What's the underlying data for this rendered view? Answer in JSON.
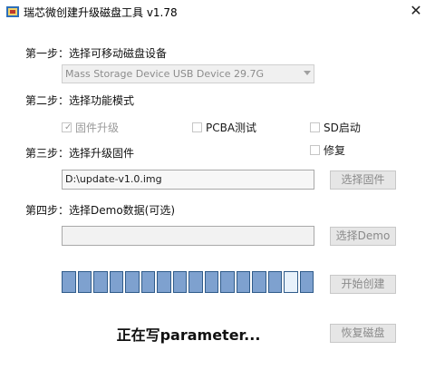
{
  "window": {
    "title": "瑞芯微创建升级磁盘工具 v1.78",
    "close_symbol": "✕"
  },
  "step1": {
    "label": "第一步：选择可移动磁盘设备",
    "selected_device": "Mass Storage Device USB Device   29.7G"
  },
  "step2": {
    "label": "第二步：选择功能模式",
    "options": {
      "firmware_upgrade": {
        "label": "固件升级",
        "checked": true
      },
      "pcba_test": {
        "label": "PCBA测试",
        "checked": false
      },
      "sd_boot": {
        "label": "SD启动",
        "checked": false
      },
      "repair": {
        "label": "修复",
        "checked": false
      }
    }
  },
  "step3": {
    "label": "第三步：选择升级固件",
    "firmware_path": "D:\\update-v1.0.img",
    "select_button": "选择固件"
  },
  "step4": {
    "label": "第四步：选择Demo数据(可选)",
    "demo_path": "",
    "select_button": "选择Demo"
  },
  "progress": {
    "segments_total": 16,
    "segments_filled": 16,
    "highlight_segment": 14
  },
  "buttons": {
    "start_create": "开始创建",
    "restore_disk": "恢复磁盘"
  },
  "status_text": "正在写parameter..."
}
